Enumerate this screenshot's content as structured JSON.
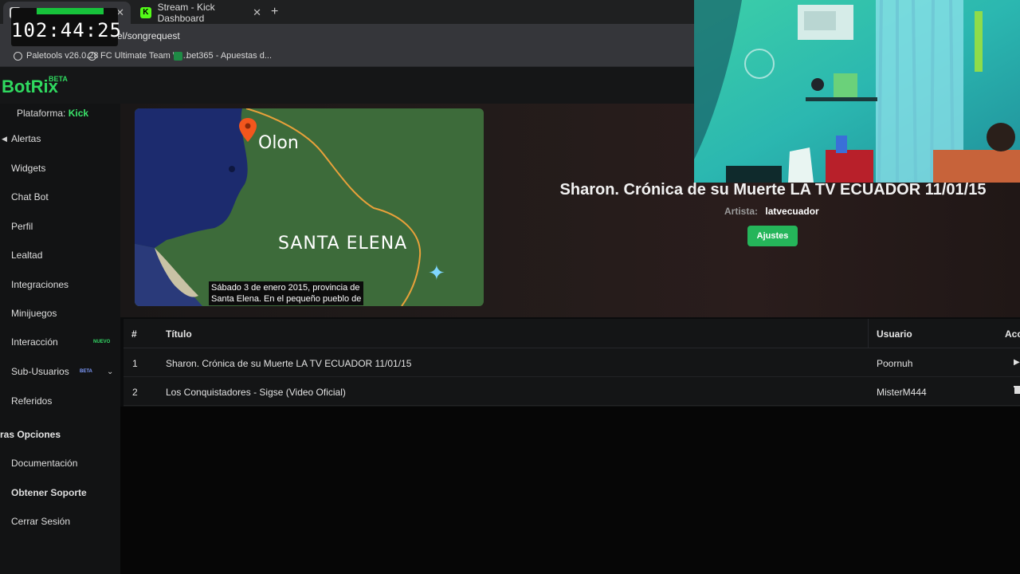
{
  "browser": {
    "tabs": [
      {
        "label": "",
        "active": true
      },
      {
        "label": "Stream - Kick Dashboard",
        "active": false
      }
    ],
    "url": "el/songrequest",
    "bookmarks": [
      "Paletools v26.0.28",
      "FC Ultimate Team W...",
      "bet365 - Apuestas d..."
    ]
  },
  "timer": {
    "time": "102:44:25"
  },
  "app": {
    "brand": "BotRix",
    "brand_tag": "BETA",
    "platform_label": "Plataforma:",
    "platform_value": "Kick"
  },
  "sidebar": {
    "items": [
      {
        "label": "Alertas"
      },
      {
        "label": "Widgets"
      },
      {
        "label": "Chat Bot"
      },
      {
        "label": "Perfil"
      },
      {
        "label": "Lealtad"
      },
      {
        "label": "Integraciones"
      },
      {
        "label": "Minijuegos"
      },
      {
        "label": "Interacción",
        "badge": "NUEVO"
      },
      {
        "label": "Sub-Usuarios",
        "badge": "BETA"
      },
      {
        "label": "Referidos"
      }
    ],
    "section_title": "ras Opciones",
    "bottom_items": [
      {
        "label": "Documentación"
      },
      {
        "label": "Obtener Soporte"
      },
      {
        "label": "Cerrar Sesión"
      }
    ]
  },
  "player": {
    "caption_line1": "Sábado 3 de enero 2015, provincia de",
    "caption_line2": "Santa Elena. En el pequeño pueblo de",
    "map_label_town": "Olon",
    "map_label_region": "SANTA ELENA",
    "now_playing_title": "Sharon. Crónica de su Muerte LA TV ECUADOR 11/01/15",
    "artist_label": "Artista:",
    "artist_value": "latvecuador",
    "settings_button": "Ajustes"
  },
  "queue": {
    "headers": {
      "num": "#",
      "title": "Título",
      "user": "Usuario",
      "actions": "Acc"
    },
    "rows": [
      {
        "num": "1",
        "title": "Sharon. Crónica de su Muerte LA TV ECUADOR 11/01/15",
        "user": "Poornuh",
        "action_icon": "play-icon"
      },
      {
        "num": "2",
        "title": "Los Conquistadores - Sigse (Video Oficial)",
        "user": "MisterM444",
        "action_icon": "trash-icon"
      }
    ]
  },
  "colors": {
    "accent": "#2fd95f",
    "button": "#25b55a",
    "map_border": "#e9a13a",
    "map_pin": "#f2561d"
  }
}
